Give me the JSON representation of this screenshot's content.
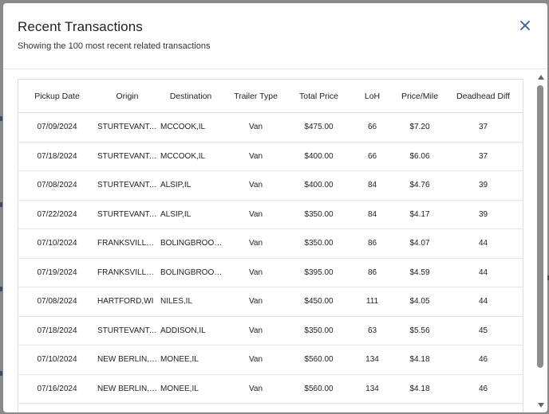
{
  "modal": {
    "title": "Recent Transactions",
    "subtitle": "Showing the 100 most recent related transactions",
    "close_icon": "close-icon"
  },
  "table": {
    "columns": [
      "Pickup Date",
      "Origin",
      "Destination",
      "Trailer Type",
      "Total Price",
      "LoH",
      "Price/Mile",
      "Deadhead Diff"
    ],
    "rows": [
      {
        "pickup_date": "07/09/2024",
        "origin": "STURTEVANT,WI",
        "destination": "MCCOOK,IL",
        "trailer_type": "Van",
        "total_price": "$475.00",
        "loh": "66",
        "price_mile": "$7.20",
        "deadhead_diff": "37"
      },
      {
        "pickup_date": "07/18/2024",
        "origin": "STURTEVANT,WI",
        "destination": "MCCOOK,IL",
        "trailer_type": "Van",
        "total_price": "$400.00",
        "loh": "66",
        "price_mile": "$6.06",
        "deadhead_diff": "37"
      },
      {
        "pickup_date": "07/08/2024",
        "origin": "STURTEVANT,WI",
        "destination": "ALSIP,IL",
        "trailer_type": "Van",
        "total_price": "$400.00",
        "loh": "84",
        "price_mile": "$4.76",
        "deadhead_diff": "39"
      },
      {
        "pickup_date": "07/22/2024",
        "origin": "STURTEVANT,WI",
        "destination": "ALSIP,IL",
        "trailer_type": "Van",
        "total_price": "$350.00",
        "loh": "84",
        "price_mile": "$4.17",
        "deadhead_diff": "39"
      },
      {
        "pickup_date": "07/10/2024",
        "origin": "FRANKSVILLE,…",
        "destination": "BOLINGBROOK…",
        "trailer_type": "Van",
        "total_price": "$350.00",
        "loh": "86",
        "price_mile": "$4.07",
        "deadhead_diff": "44"
      },
      {
        "pickup_date": "07/19/2024",
        "origin": "FRANKSVILLE,…",
        "destination": "BOLINGBROOK…",
        "trailer_type": "Van",
        "total_price": "$395.00",
        "loh": "86",
        "price_mile": "$4.59",
        "deadhead_diff": "44"
      },
      {
        "pickup_date": "07/08/2024",
        "origin": "HARTFORD,WI",
        "destination": "NILES,IL",
        "trailer_type": "Van",
        "total_price": "$450.00",
        "loh": "111",
        "price_mile": "$4.05",
        "deadhead_diff": "44"
      },
      {
        "pickup_date": "07/18/2024",
        "origin": "STURTEVANT,WI",
        "destination": "ADDISON,IL",
        "trailer_type": "Van",
        "total_price": "$350.00",
        "loh": "63",
        "price_mile": "$5.56",
        "deadhead_diff": "45"
      },
      {
        "pickup_date": "07/10/2024",
        "origin": "NEW BERLIN,WI",
        "destination": "MONEE,IL",
        "trailer_type": "Van",
        "total_price": "$560.00",
        "loh": "134",
        "price_mile": "$4.18",
        "deadhead_diff": "46"
      },
      {
        "pickup_date": "07/16/2024",
        "origin": "NEW BERLIN,WI",
        "destination": "MONEE,IL",
        "trailer_type": "Van",
        "total_price": "$560.00",
        "loh": "134",
        "price_mile": "$4.18",
        "deadhead_diff": "46"
      }
    ]
  },
  "colors": {
    "overlay": "#7a7a7a",
    "close_icon": "#3a5a8c",
    "border": "#dedede",
    "scroll_thumb": "#8c8c8c"
  }
}
